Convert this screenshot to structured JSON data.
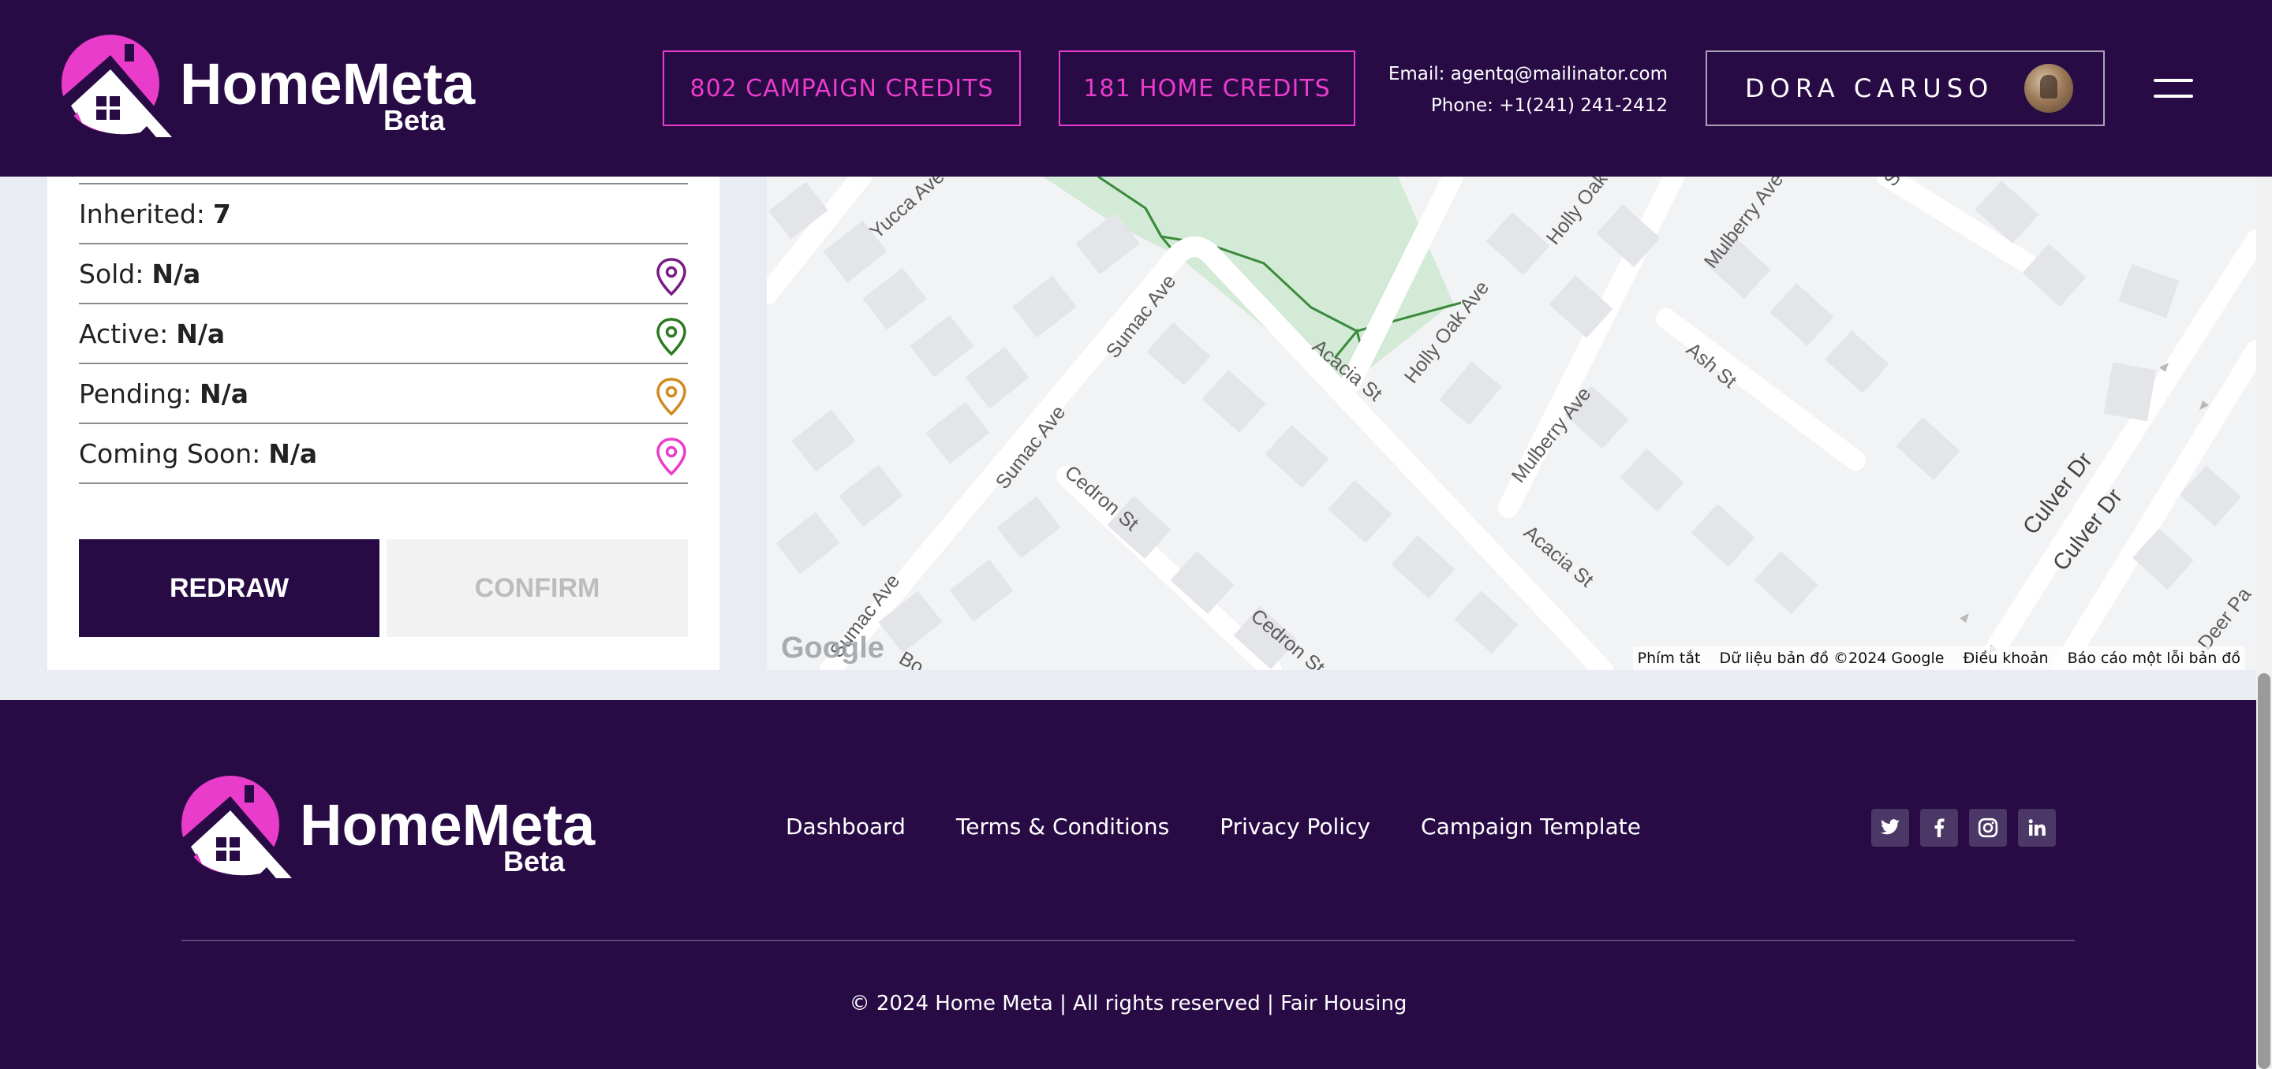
{
  "header": {
    "logo": {
      "name": "HomeMeta",
      "tag": "Beta"
    },
    "campaign_credits": "802 CAMPAIGN CREDITS",
    "home_credits": "181 HOME CREDITS",
    "contact": {
      "email_label": "Email:",
      "email": "agentq@mailinator.com",
      "phone_label": "Phone:",
      "phone": "+1(241) 241-2412"
    },
    "user_name": "DORA CARUSO"
  },
  "stats": {
    "inherited_label": "Inherited:",
    "inherited_value": "7",
    "sold_label": "Sold:",
    "sold_value": "N/a",
    "active_label": "Active:",
    "active_value": "N/a",
    "pending_label": "Pending:",
    "pending_value": "N/a",
    "coming_soon_label": "Coming Soon:",
    "coming_soon_value": "N/a"
  },
  "pin_colors": {
    "sold": "#7a1c86",
    "active": "#2d7a22",
    "pending": "#d08b1e",
    "coming_soon": "#e93ccb"
  },
  "actions": {
    "redraw": "REDRAW",
    "confirm": "CONFIRM"
  },
  "map": {
    "streets": [
      "Yucca Ave",
      "Holly Oak",
      "Mulberry Ave",
      "St",
      "Sumac Ave",
      "Acacia St",
      "Holly Oak Ave",
      "Ash St",
      "Mulberry Ave",
      "Sumac Ave",
      "Cedron St",
      "Culver Dr",
      "Culver Dr",
      "Acacia St",
      "Cedron St",
      "Sumac Ave",
      "Bo",
      "Deer Pa"
    ],
    "attribution": {
      "google": "Google",
      "shortcuts": "Phím tắt",
      "map_data": "Dữ liệu bản đồ ©2024 Google",
      "terms": "Điều khoản",
      "report": "Báo cáo một lỗi bản đồ"
    }
  },
  "footer": {
    "logo": {
      "name": "HomeMeta",
      "tag": "Beta"
    },
    "links": [
      "Dashboard",
      "Terms & Conditions",
      "Privacy Policy",
      "Campaign Template"
    ],
    "socials": [
      "twitter-icon",
      "facebook-icon",
      "instagram-icon",
      "linkedin-icon"
    ],
    "copyright": "© 2024 Home Meta | All rights reserved | Fair Housing"
  },
  "colors": {
    "brand_dark": "#280b45",
    "brand_pink": "#e93ccb"
  }
}
